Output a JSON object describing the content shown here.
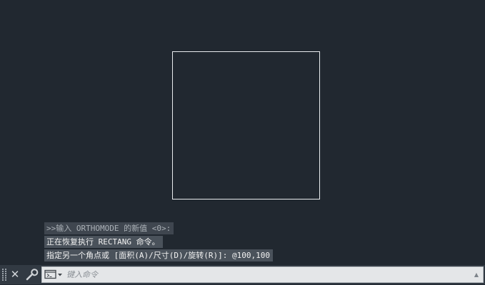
{
  "command_history": [
    ">>输入 ORTHOMODE 的新值 <0>:",
    "正在恢复执行 RECTANG 命令。",
    "指定另一个角点或 [面积(A)/尺寸(D)/旋转(R)]: @100,100"
  ],
  "command_line": {
    "placeholder": "键入命令",
    "value": ""
  },
  "icons": {
    "grip": "grip-icon",
    "close": "close-icon",
    "customize": "wrench-icon",
    "prompt": "command-prompt-icon",
    "history": "chevron-up-icon"
  },
  "colors": {
    "canvas": "#212830",
    "rectangle_stroke": "#e9ecef",
    "command_bar": "#323a43",
    "input_background": "#e4e6e8"
  }
}
